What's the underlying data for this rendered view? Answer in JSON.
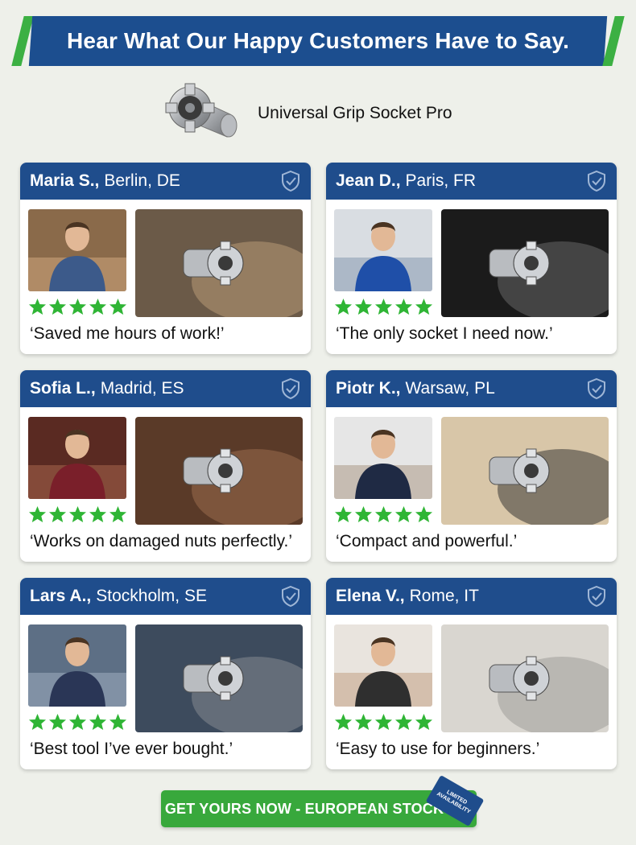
{
  "header": {
    "title": "Hear What Our Happy Customers Have to Say."
  },
  "product": {
    "name": "Universal Grip Socket Pro",
    "icon": "socket-product-icon"
  },
  "reviews": [
    {
      "name": "Maria S.,",
      "location": "Berlin, DE",
      "rating": 5,
      "quote": "‘Saved me hours of work!’"
    },
    {
      "name": "Jean D.,",
      "location": "Paris, FR",
      "rating": 5,
      "quote": "‘The only socket I need now.’"
    },
    {
      "name": "Sofia L.,",
      "location": "Madrid, ES",
      "rating": 5,
      "quote": "‘Works on damaged nuts perfectly.’"
    },
    {
      "name": "Piotr K.,",
      "location": "Warsaw, PL",
      "rating": 5,
      "quote": "‘Compact and powerful.’"
    },
    {
      "name": "Lars A.,",
      "location": "Stockholm, SE",
      "rating": 5,
      "quote": "‘Best tool I’ve ever bought.’"
    },
    {
      "name": "Elena V.,",
      "location": "Rome, IT",
      "rating": 5,
      "quote": "‘Easy to use for beginners.’"
    }
  ],
  "cta": {
    "label": "GET YOURS NOW - EUROPEAN STOCK",
    "badge_line1": "LIMITED",
    "badge_line2": "AVAILABILITY"
  },
  "colors": {
    "brand_blue": "#1f4d8c",
    "accent_green": "#3cb043",
    "star_green": "#2fb535",
    "background": "#eef0ea"
  }
}
